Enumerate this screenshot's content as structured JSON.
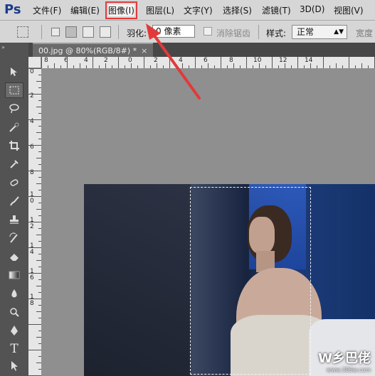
{
  "app": {
    "logo": "Ps"
  },
  "menu": {
    "items": [
      {
        "label": "文件(F)"
      },
      {
        "label": "编辑(E)"
      },
      {
        "label": "图像(I)"
      },
      {
        "label": "图层(L)"
      },
      {
        "label": "文字(Y)"
      },
      {
        "label": "选择(S)"
      },
      {
        "label": "滤镜(T)"
      },
      {
        "label": "3D(D)"
      },
      {
        "label": "视图(V)"
      }
    ]
  },
  "options": {
    "feather_label": "羽化:",
    "feather_value": "0 像素",
    "antialias_label": "消除锯齿",
    "style_label": "样式:",
    "style_value": "正常",
    "width_label": "宽度"
  },
  "document": {
    "tab_label": "00.jpg @ 80%(RGB/8#) *",
    "close_glyph": "×"
  },
  "ruler": {
    "top_labels": [
      "8",
      "6",
      "4",
      "2",
      "0",
      "2",
      "4",
      "6",
      "8",
      "10",
      "12",
      "14"
    ],
    "left_labels": [
      "0",
      "2",
      "4",
      "6",
      "8",
      "1\n0",
      "1\n2",
      "1\n4",
      "1\n6",
      "1\n8"
    ]
  },
  "watermark": {
    "main": "W乡巴佬",
    "sub": "www.386w.com"
  },
  "colors": {
    "highlight": "#e23a3a",
    "menubar": "#d6d6d6",
    "workspace": "#8f8f8f"
  },
  "icons": [
    "move-icon",
    "marquee-icon",
    "lasso-icon",
    "quick-select-icon",
    "crop-icon",
    "eyedropper-icon",
    "healing-icon",
    "brush-icon",
    "stamp-icon",
    "history-brush-icon",
    "eraser-icon",
    "gradient-icon",
    "blur-icon",
    "dodge-icon",
    "pen-icon",
    "type-icon",
    "path-select-icon"
  ]
}
